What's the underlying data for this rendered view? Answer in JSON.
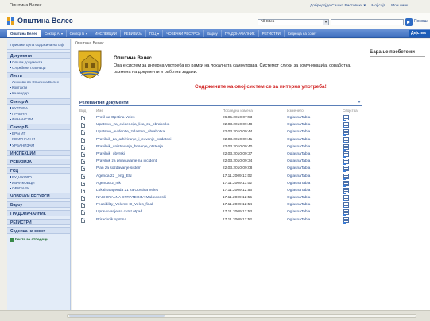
{
  "topbar": {
    "site_name": "Општина Велес",
    "welcome": "Добредојде Сашко Ристовски ▾",
    "my_site": "Мој сајт",
    "my_links": "Мои линк"
  },
  "header": {
    "title": "Општина Велес",
    "search_scope": "All Sites",
    "help": "Помош",
    "site_actions": "Дејства"
  },
  "nav": {
    "tabs": [
      {
        "label": "Општина Велес",
        "active": true,
        "dropdown": false
      },
      {
        "label": "Сектор А",
        "active": false,
        "dropdown": true
      },
      {
        "label": "Сектор Б",
        "active": false,
        "dropdown": true
      },
      {
        "label": "ИНСПЕКЦИИ",
        "active": false,
        "dropdown": false
      },
      {
        "label": "РЕВИЗИЈА",
        "active": false,
        "dropdown": false
      },
      {
        "label": "ГСЦ",
        "active": false,
        "dropdown": true
      },
      {
        "label": "ЧОВЕЧКИ РЕСУРСИ",
        "active": false,
        "dropdown": false
      },
      {
        "label": "Бароу",
        "active": false,
        "dropdown": false
      },
      {
        "label": "ГРАДОНАЧАЛНИК",
        "active": false,
        "dropdown": false
      },
      {
        "label": "РЕГИСТРИ",
        "active": false,
        "dropdown": false
      },
      {
        "label": "Седница на совет",
        "active": false,
        "dropdown": false
      }
    ]
  },
  "quicklaunch": {
    "view_all": "Прикажи цела содржина на сајт",
    "sections": [
      {
        "title": "Документи",
        "items": [
          "Општи документи",
          "Службени гласници"
        ]
      },
      {
        "title": "Листи",
        "items": [
          "Линкови во Општина Велес",
          "Контакти",
          "Календар"
        ]
      },
      {
        "title": "Сектор А",
        "items": [
          "КУЛТУРА",
          "ПРАВНИ",
          "ФИНАНСИИ"
        ]
      },
      {
        "title": "Сектор Б",
        "items": [
          "ЕР и ИТ",
          "КОМУНАЛНИ",
          "УРБАНИЗАМ"
        ]
      },
      {
        "title": "ИНСПЕКЦИИ",
        "items": []
      },
      {
        "title": "РЕВИЗИЈА",
        "items": []
      },
      {
        "title": "ГСЦ",
        "items": [
          "БУЏАКОВО",
          "ИВАНКОВЦИ",
          "ОРИЗАРИ"
        ]
      },
      {
        "title": "ЧОВЕЧКИ РЕСУРСИ",
        "items": []
      },
      {
        "title": "Бароу",
        "items": []
      },
      {
        "title": "ГРАДОНАЧАЛНИК",
        "items": []
      },
      {
        "title": "РЕГИСТРИ",
        "items": []
      },
      {
        "title": "Седница на совет",
        "items": []
      }
    ],
    "recycle_bin": "Канта за отпадоци"
  },
  "main": {
    "breadcrumb": "Општина Велес",
    "heading": "Општина Велес",
    "description": "Ова е систем за интерна употреба во рамки на локалната самоуправа. Системот служи за комуникација, соработка, размена на документи и работни задачи.",
    "warning": "Содржините на овој систем се за интерна употреба!",
    "side_title": "Барање пребетеми"
  },
  "documents": {
    "title": "Релевантни документи",
    "columns": {
      "type": "Вид",
      "name": "Име",
      "modified": "Последна измена",
      "by": "Изменето",
      "workflow": "Својства"
    },
    "rows": [
      {
        "name": "Profil na Opstina Veles",
        "date": "26.05.2010 07:53",
        "by": "OglasnaTabla"
      },
      {
        "name": "Upatstvo_za_evidencija_lica_za_obrabotka",
        "date": "22.03.2010 09:48",
        "by": "OglasnaTabla"
      },
      {
        "name": "Upatstvo_evidentie_zvlasteni_obrabotka",
        "date": "22.03.2010 09:44",
        "by": "OglasnaTabla"
      },
      {
        "name": "Pravilnik_za_arhiviranje_i_cuvanje_podatoci",
        "date": "22.03.2010 09:41",
        "by": "OglasnaTabla"
      },
      {
        "name": "Pravilnik_unistuvanje_brisenje_otstenje",
        "date": "22.03.2010 09:40",
        "by": "OglasnaTabla"
      },
      {
        "name": "Pravilnik_obvrski",
        "date": "22.03.2010 09:37",
        "by": "OglasnaTabla"
      },
      {
        "name": "Pravilnik za prijavuvanje na incidenti",
        "date": "22.03.2010 09:34",
        "by": "OglasnaTabla"
      },
      {
        "name": "Plan za sozdavanje sistem",
        "date": "22.03.2010 09:08",
        "by": "OglasnaTabla"
      },
      {
        "name": "Agenda 22 _eng_EN",
        "date": "17.11.2009 13:02",
        "by": "OglasnaTabla"
      },
      {
        "name": "Agenda22_mk",
        "date": "17.11.2009 13:02",
        "by": "OglasnaTabla"
      },
      {
        "name": "Lokalna agenda 21 za Opstina Veles",
        "date": "17.11.2009 12:56",
        "by": "OglasnaTabla"
      },
      {
        "name": "NACIONALNA STRATEGIJA Makedonski",
        "date": "17.11.2009 12:55",
        "by": "OglasnaTabla"
      },
      {
        "name": "Feasibility_Volume III_Veles_final",
        "date": "17.11.2009 12:54",
        "by": "OglasnaTabla"
      },
      {
        "name": "Upravuvanje so cvrst otpad",
        "date": "17.11.2009 12:53",
        "by": "OglasnaTabla"
      },
      {
        "name": "Prirachnik opstina",
        "date": "17.11.2009 12:52",
        "by": "OglasnaTabla"
      }
    ]
  },
  "colors": {
    "nav_bar": "#4f7fcc",
    "link": "#2b4f8f",
    "warning": "#d12222",
    "quicklaunch_bg": "#e3ecf8"
  },
  "icons": [
    "sharepoint-logo-icon",
    "search-go-icon",
    "document-icon",
    "workflow-icon",
    "recycle-bin-icon",
    "crest-icon"
  ]
}
